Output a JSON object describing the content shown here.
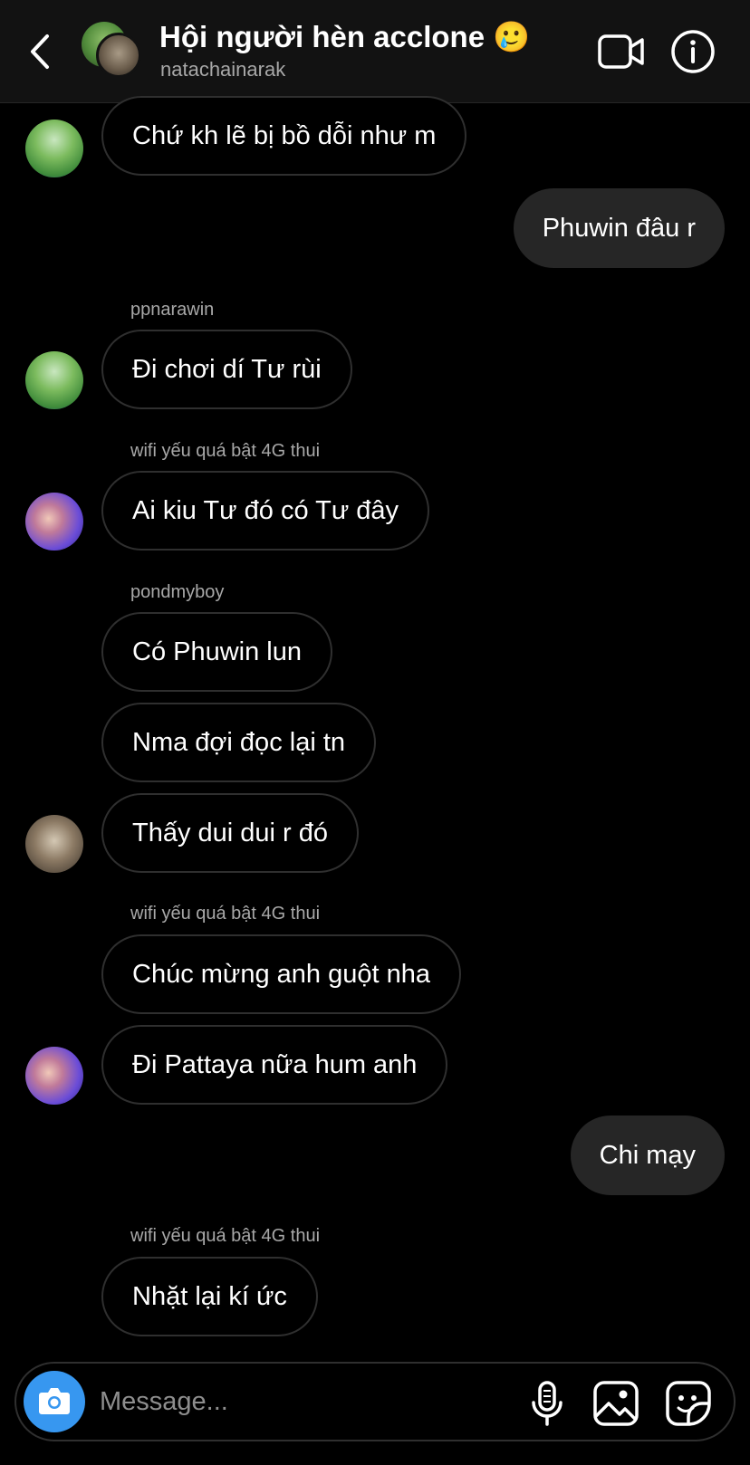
{
  "header": {
    "title": "Hội người hèn acclone 🥲",
    "subtitle": "natachainarak"
  },
  "messages": [
    {
      "text": "Chứ kh lẽ bị bồ dỗi như m"
    },
    {
      "text": "Phuwin đâu r"
    },
    {
      "sender": "ppnarawin",
      "text": "Đi chơi dí Tư rùi"
    },
    {
      "sender": "wifi yếu quá bật 4G thui",
      "text": "Ai kiu Tư đó có Tư đây"
    },
    {
      "sender": "pondmyboy",
      "text": "Có Phuwin lun"
    },
    {
      "text": "Nma đợi đọc lại tn"
    },
    {
      "text": "Thấy dui dui r đó"
    },
    {
      "sender": "wifi yếu quá bật 4G thui",
      "text": "Chúc mừng anh guột nha"
    },
    {
      "text": "Đi Pattaya nữa hum anh"
    },
    {
      "text": "Chi mạy"
    },
    {
      "sender": "wifi yếu quá bật 4G thui",
      "text": "Nhặt lại kí ức"
    }
  ],
  "composer": {
    "placeholder": "Message..."
  },
  "icons": {
    "back": "chevron-left-icon",
    "video": "video-camera-icon",
    "info": "info-icon",
    "camera": "camera-icon",
    "mic": "microphone-icon",
    "gallery": "image-icon",
    "sticker": "sticker-icon"
  },
  "colors": {
    "background": "#000000",
    "header_bg": "#121212",
    "outgoing_bubble": "#262626",
    "incoming_border": "#2f2f2f",
    "camera_button": "#3797f0",
    "secondary_text": "#a8a8a8"
  }
}
